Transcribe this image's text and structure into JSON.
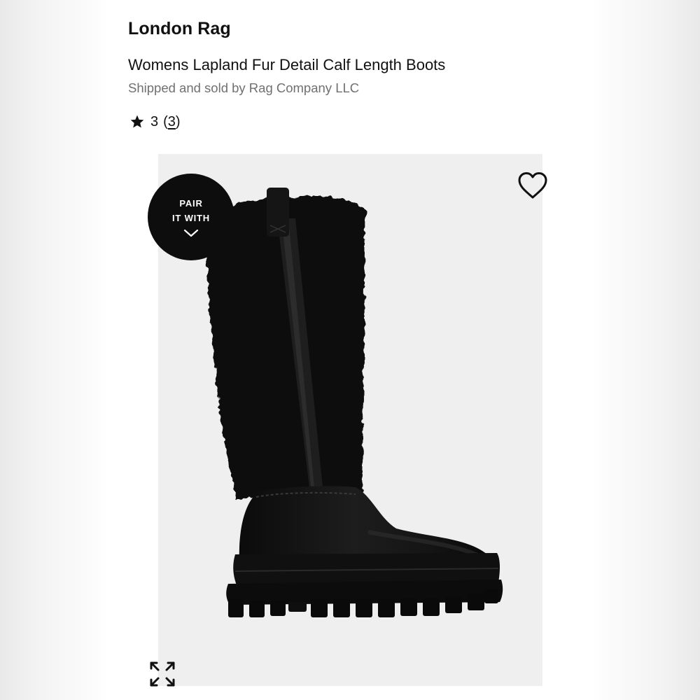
{
  "product": {
    "brand": "London Rag",
    "title": "Womens Lapland Fur Detail Calf Length Boots",
    "seller": "Shipped and sold by Rag Company LLC",
    "rating": {
      "value": "3",
      "open_paren": "(",
      "review_count": "3",
      "close_paren": ")",
      "icon": "star-icon"
    }
  },
  "image": {
    "alt": "Black calf length boot with shearling fur shaft and chunky lug sole",
    "background_color": "#efefef"
  },
  "pair_badge": {
    "line1": "PAIR",
    "line2": "IT WITH",
    "icon": "chevron-down-icon"
  },
  "icons": {
    "wishlist": "heart-icon",
    "expand": "expand-icon"
  },
  "colors": {
    "text_primary": "#111111",
    "text_secondary": "#707070",
    "badge_background": "#0d0d0d",
    "boot": "#121212"
  }
}
